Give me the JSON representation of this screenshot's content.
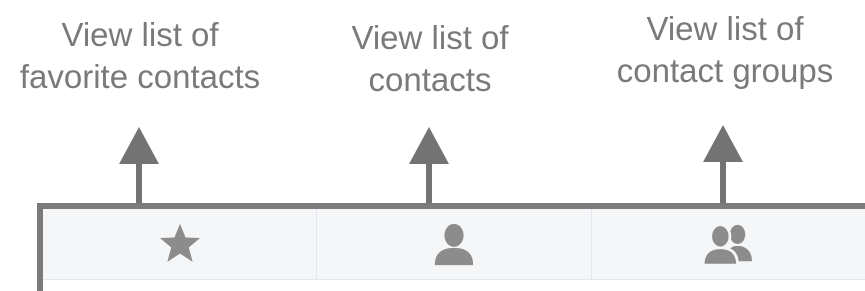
{
  "callouts": {
    "favorites": {
      "line1": "View list of",
      "line2": "favorite contacts"
    },
    "contacts": {
      "line1": "View list of",
      "line2": "contacts"
    },
    "groups": {
      "line1": "View list of",
      "line2": "contact groups"
    }
  },
  "tabs": [
    {
      "icon": "star-icon"
    },
    {
      "icon": "person-icon"
    },
    {
      "icon": "group-icon"
    }
  ],
  "colors": {
    "callout_text": "#7a7a7a",
    "arrow": "#737373",
    "frame": "#7b7b7b",
    "tabbar_bg": "#f4f6f8",
    "icon": "#8c8c8c"
  }
}
